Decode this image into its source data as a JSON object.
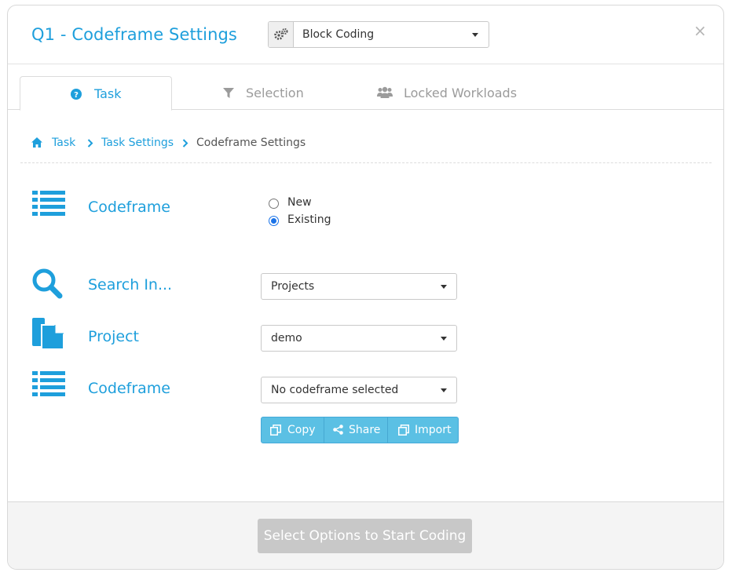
{
  "header": {
    "title": "Q1 - Codeframe Settings",
    "mode_select": {
      "value": "Block Coding",
      "icon": "gears-icon"
    },
    "close_label": "×"
  },
  "tabs": [
    {
      "label": "Task",
      "icon": "question-circle-icon",
      "active": true
    },
    {
      "label": "Selection",
      "icon": "filter-icon",
      "active": false
    },
    {
      "label": "Locked Workloads",
      "icon": "users-icon",
      "active": false
    }
  ],
  "breadcrumb": [
    "Task",
    "Task Settings",
    "Codeframe Settings"
  ],
  "form": {
    "codeframe_mode": {
      "label": "Codeframe",
      "options": [
        "New",
        "Existing"
      ],
      "selected": "Existing"
    },
    "search_in": {
      "label": "Search In...",
      "value": "Projects"
    },
    "project": {
      "label": "Project",
      "value": "demo"
    },
    "codeframe": {
      "label": "Codeframe",
      "value": "No codeframe selected"
    },
    "actions": [
      "Copy",
      "Share",
      "Import"
    ]
  },
  "footer": {
    "start_label": "Select Options to Start Coding",
    "enabled": false
  },
  "colors": {
    "accent": "#1e9fdc",
    "button_info": "#5bc0e4",
    "disabled": "#c8c8c8"
  }
}
